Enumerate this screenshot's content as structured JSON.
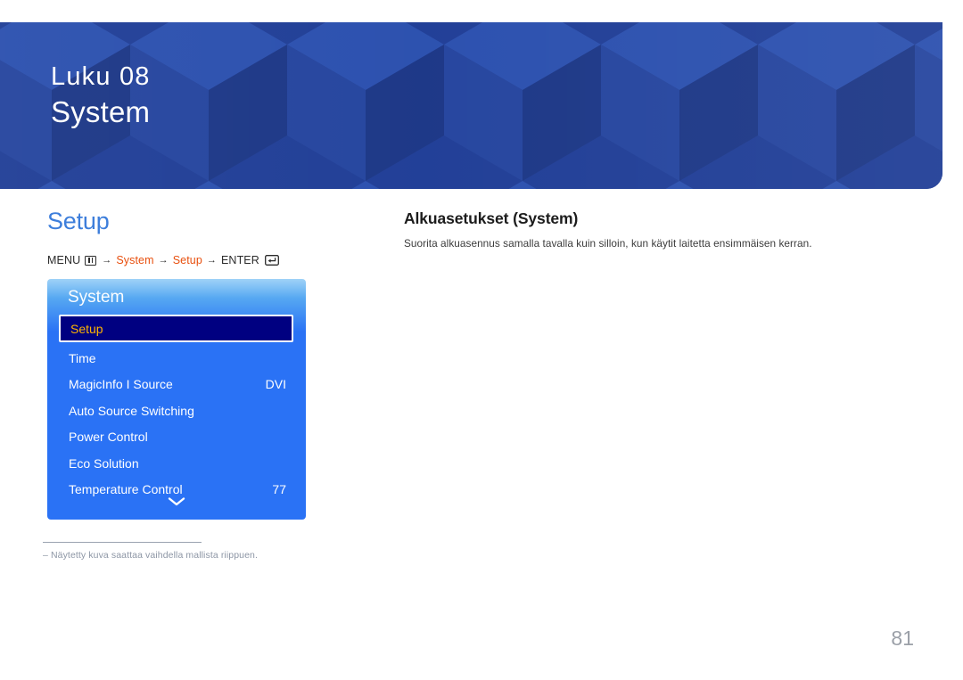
{
  "banner": {
    "chapter": "Luku 08",
    "title": "System"
  },
  "section": {
    "title": "Setup"
  },
  "menu_path": {
    "menu_label": "MENU",
    "menu_icon": "menu-bars-icon",
    "arrow": "→",
    "step1": "System",
    "step2": "Setup",
    "enter_label": "ENTER",
    "enter_icon": "enter-return-icon"
  },
  "osd": {
    "title": "System",
    "items": [
      {
        "label": "Setup",
        "value": "",
        "selected": true
      },
      {
        "label": "Time",
        "value": "",
        "selected": false
      },
      {
        "label": "MagicInfo I Source",
        "value": "DVI",
        "selected": false
      },
      {
        "label": "Auto Source Switching",
        "value": "",
        "selected": false
      },
      {
        "label": "Power Control",
        "value": "",
        "selected": false
      },
      {
        "label": "Eco Solution",
        "value": "",
        "selected": false
      },
      {
        "label": "Temperature Control",
        "value": "77",
        "selected": false
      }
    ],
    "scroll_icon": "chevron-down-icon"
  },
  "footnote": {
    "text": "–  Näytetty kuva saattaa vaihdella mallista riippuen."
  },
  "content": {
    "heading": "Alkuasetukset (System)",
    "body": "Suorita alkuasennus samalla tavalla kuin silloin, kun käytit laitetta ensimmäisen kerran."
  },
  "page_number": "81",
  "colors": {
    "banner_bg": "#1f3d96",
    "section_title": "#3d7edb",
    "path_keyword": "#e8500f",
    "osd_blue": "#2a72f5",
    "osd_selected_bg": "#000081",
    "osd_selected_text": "#ffb400",
    "page_number": "#9ba0a8"
  }
}
